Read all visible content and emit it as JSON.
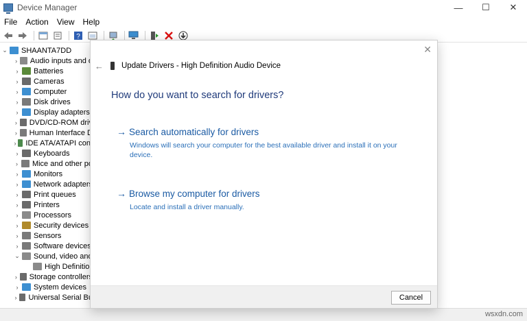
{
  "window": {
    "title": "Device Manager",
    "controls": {
      "minimize": "—",
      "maximize": "☐",
      "close": "✕"
    }
  },
  "menu": [
    "File",
    "Action",
    "View",
    "Help"
  ],
  "tree": {
    "root": "SHAANTA7DD",
    "items": [
      {
        "label": "Audio inputs and o",
        "color": "#8a8a8a",
        "expanded": false
      },
      {
        "label": "Batteries",
        "color": "#5b8a3a",
        "expanded": false
      },
      {
        "label": "Cameras",
        "color": "#6a6a6a",
        "expanded": false
      },
      {
        "label": "Computer",
        "color": "#3d8fd1",
        "expanded": false
      },
      {
        "label": "Disk drives",
        "color": "#7a7a7a",
        "expanded": false
      },
      {
        "label": "Display adapters",
        "color": "#3d8fd1",
        "expanded": false
      },
      {
        "label": "DVD/CD-ROM driv",
        "color": "#6a6a6a",
        "expanded": false
      },
      {
        "label": "Human Interface D",
        "color": "#7a7a7a",
        "expanded": false
      },
      {
        "label": "IDE ATA/ATAPI cont",
        "color": "#4c8a4c",
        "expanded": false
      },
      {
        "label": "Keyboards",
        "color": "#6a6a6a",
        "expanded": false
      },
      {
        "label": "Mice and other po",
        "color": "#7a7a7a",
        "expanded": false
      },
      {
        "label": "Monitors",
        "color": "#3d8fd1",
        "expanded": false
      },
      {
        "label": "Network adapters",
        "color": "#3d8fd1",
        "expanded": false
      },
      {
        "label": "Print queues",
        "color": "#6a6a6a",
        "expanded": false
      },
      {
        "label": "Printers",
        "color": "#6a6a6a",
        "expanded": false
      },
      {
        "label": "Processors",
        "color": "#8a8a8a",
        "expanded": false
      },
      {
        "label": "Security devices",
        "color": "#b08a2a",
        "expanded": false
      },
      {
        "label": "Sensors",
        "color": "#7a7a7a",
        "expanded": false
      },
      {
        "label": "Software devices",
        "color": "#7a7a7a",
        "expanded": false
      },
      {
        "label": "Sound, video and",
        "color": "#8a8a8a",
        "expanded": true
      },
      {
        "label": "High Definitio",
        "color": "#8a8a8a",
        "child": true
      },
      {
        "label": "Storage controllers",
        "color": "#6a6a6a",
        "expanded": false
      },
      {
        "label": "System devices",
        "color": "#3d8fd1",
        "expanded": false
      },
      {
        "label": "Universal Serial Bu",
        "color": "#6a6a6a",
        "expanded": false
      }
    ]
  },
  "dialog": {
    "close": "✕",
    "back": "←",
    "header": "Update Drivers - High Definition Audio Device",
    "question": "How do you want to search for drivers?",
    "option_auto": {
      "title": "Search automatically for drivers",
      "desc": "Windows will search your computer for the best available driver and install it on your device."
    },
    "option_browse": {
      "title": "Browse my computer for drivers",
      "desc": "Locate and install a driver manually."
    },
    "cancel": "Cancel"
  },
  "watermark": "wsxdn.com",
  "colors": {
    "link": "#1a5aa3",
    "heading": "#1f3a7a"
  }
}
